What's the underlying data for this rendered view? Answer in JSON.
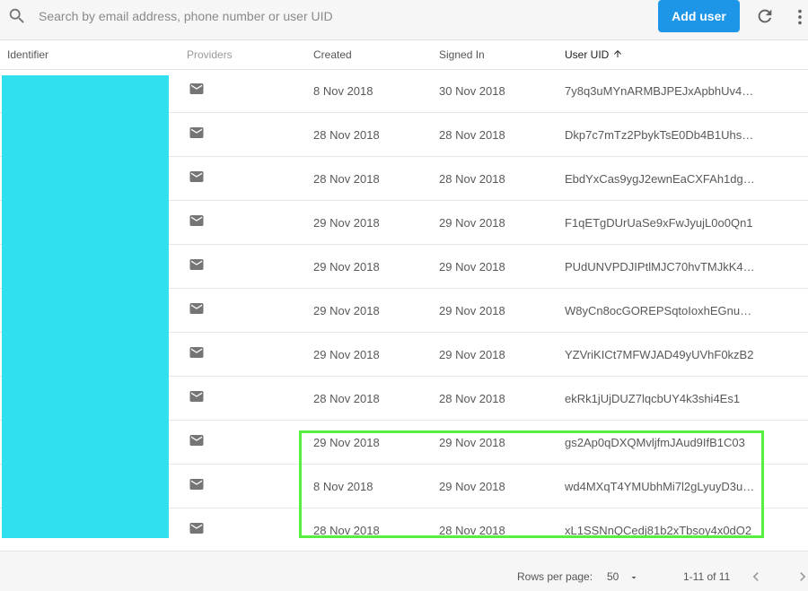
{
  "search": {
    "placeholder": "Search by email address, phone number or user UID"
  },
  "toolbar": {
    "add_user_label": "Add user"
  },
  "columns": {
    "identifier": "Identifier",
    "providers": "Providers",
    "created": "Created",
    "signed_in": "Signed In",
    "user_uid": "User UID"
  },
  "rows": [
    {
      "provider_icon": "mail-icon",
      "created": "8 Nov 2018",
      "signed_in": "30 Nov 2018",
      "uid": "7y8q3uMYnARMBJPEJxApbhUv4X…"
    },
    {
      "provider_icon": "mail-icon",
      "created": "28 Nov 2018",
      "signed_in": "28 Nov 2018",
      "uid": "Dkp7c7mTz2PbykTsE0Db4B1UhsP2"
    },
    {
      "provider_icon": "mail-icon",
      "created": "28 Nov 2018",
      "signed_in": "28 Nov 2018",
      "uid": "EbdYxCas9ygJ2ewnEaCXFAh1dgq2"
    },
    {
      "provider_icon": "mail-icon",
      "created": "29 Nov 2018",
      "signed_in": "29 Nov 2018",
      "uid": "F1qETgDUrUaSe9xFwJyujL0o0Qn1"
    },
    {
      "provider_icon": "mail-icon",
      "created": "29 Nov 2018",
      "signed_in": "29 Nov 2018",
      "uid": "PUdUNVPDJIPtlMJC70hvTMJkK4…"
    },
    {
      "provider_icon": "mail-icon",
      "created": "29 Nov 2018",
      "signed_in": "29 Nov 2018",
      "uid": "W8yCn8ocGOREPSqtoIoxhEGnuqw1"
    },
    {
      "provider_icon": "mail-icon",
      "created": "29 Nov 2018",
      "signed_in": "29 Nov 2018",
      "uid": "YZVriKICt7MFWJAD49yUVhF0kzB2"
    },
    {
      "provider_icon": "mail-icon",
      "created": "28 Nov 2018",
      "signed_in": "28 Nov 2018",
      "uid": "ekRk1jUjDUZ7lqcbUY4k3shi4Es1"
    },
    {
      "provider_icon": "mail-icon",
      "created": "29 Nov 2018",
      "signed_in": "29 Nov 2018",
      "uid": "gs2Ap0qDXQMvljfmJAud9IfB1C03"
    },
    {
      "provider_icon": "mail-icon",
      "created": "8 Nov 2018",
      "signed_in": "29 Nov 2018",
      "uid": "wd4MXqT4YMUbhMi7l2gLyuyD3u…"
    },
    {
      "provider_icon": "mail-icon",
      "created": "28 Nov 2018",
      "signed_in": "28 Nov 2018",
      "uid": "xL1SSNnQCedj81b2xTbsoy4x0dO2"
    }
  ],
  "footer": {
    "rows_per_page_label": "Rows per page:",
    "rows_per_page_value": "50",
    "range": "1-11 of 11"
  },
  "colors": {
    "accent": "#1e96e8",
    "redaction": "#30e0ef",
    "highlight": "#57ee3d"
  }
}
